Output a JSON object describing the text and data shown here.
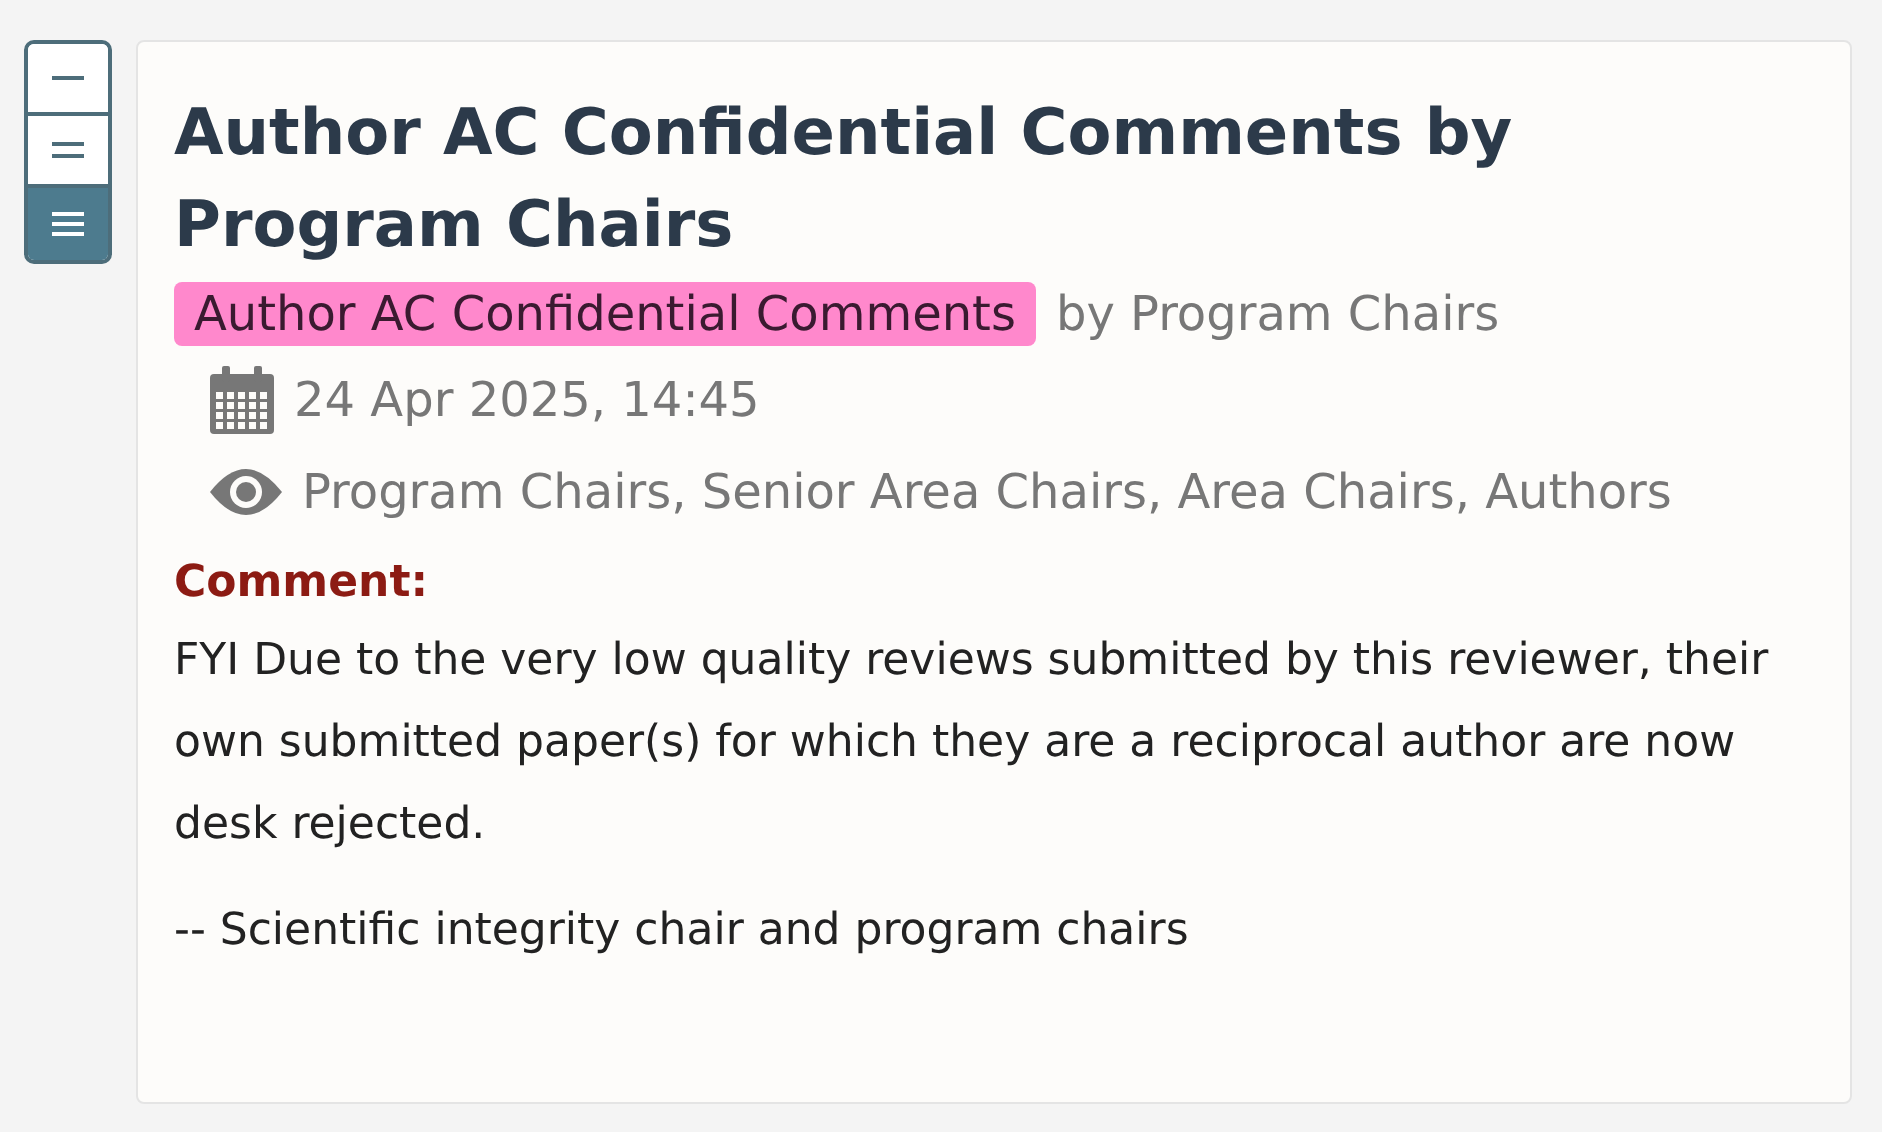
{
  "view_toggle": [
    {
      "kind": "single",
      "selected": false
    },
    {
      "kind": "double",
      "selected": false
    },
    {
      "kind": "triple",
      "selected": true
    }
  ],
  "note": {
    "title": "Author AC Confidential Comments by Program Chairs",
    "invitation": "Author AC Confidential Comments",
    "signature": "by Program Chairs",
    "date": "24 Apr 2025, 14:45",
    "readers": "Program Chairs, Senior Area Chairs, Area Chairs, Authors",
    "field_label": "Comment:",
    "paragraphs": [
      "FYI Due to the very low quality reviews submitted by this reviewer, their own submitted paper(s) for which they are a reciprocal author are now desk rejected.",
      "-- Scientific integrity chair and program chairs"
    ]
  }
}
